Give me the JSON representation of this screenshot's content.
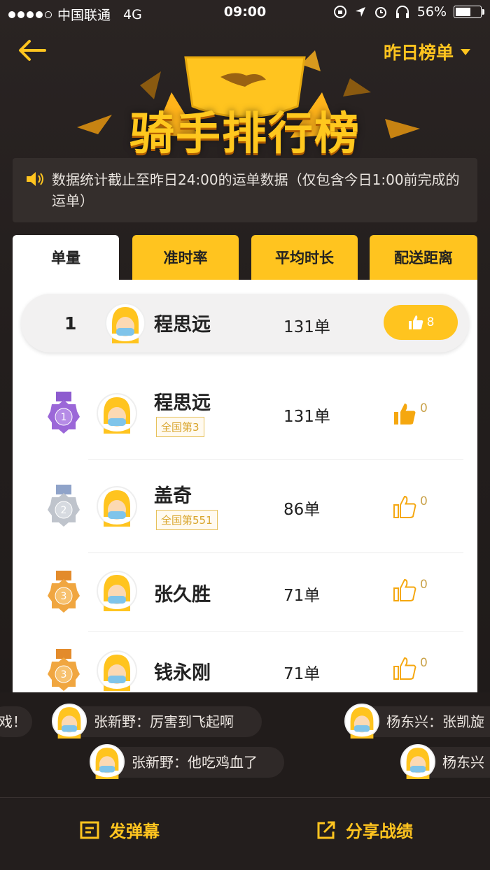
{
  "status_bar": {
    "carrier": "中国联通",
    "network": "4G",
    "time": "09:00",
    "battery": "56%"
  },
  "header": {
    "period_selector": "昨日榜单",
    "title": "骑手排行榜"
  },
  "notice": {
    "text": "数据统计截止至昨日24:00的运单数据（仅包含今日1:00前完成的运单）"
  },
  "tabs": [
    {
      "label": "单量",
      "active": true
    },
    {
      "label": "准时率",
      "active": false
    },
    {
      "label": "平均时长",
      "active": false
    },
    {
      "label": "配送距离",
      "active": false
    }
  ],
  "my_rank": {
    "rank": "1",
    "name": "程思远",
    "count": "131单",
    "likes": "8"
  },
  "rankings": [
    {
      "medal": "1",
      "name": "程思远",
      "badge": "全国第3",
      "count": "131单",
      "likes": "0"
    },
    {
      "medal": "2",
      "name": "盖奇",
      "badge": "全国第551",
      "count": "86单",
      "likes": "0"
    },
    {
      "medal": "3",
      "name": "张久胜",
      "badge": "",
      "count": "71单",
      "likes": "0"
    },
    {
      "medal": "3",
      "name": "钱永刚",
      "badge": "",
      "count": "71单",
      "likes": "0"
    }
  ],
  "danmaku": [
    {
      "text": "戏！"
    },
    {
      "text": "张新野：厉害到飞起啊"
    },
    {
      "text": "杨东兴：张凯旋"
    },
    {
      "text": "张新野：他吃鸡血了"
    },
    {
      "text": "杨东兴"
    }
  ],
  "colors": {
    "accent": "#ffc41f",
    "background": "#231e1d",
    "card": "#ffffff"
  },
  "bottom_bar": {
    "comment_button": "发弹幕",
    "share_button": "分享战绩"
  }
}
